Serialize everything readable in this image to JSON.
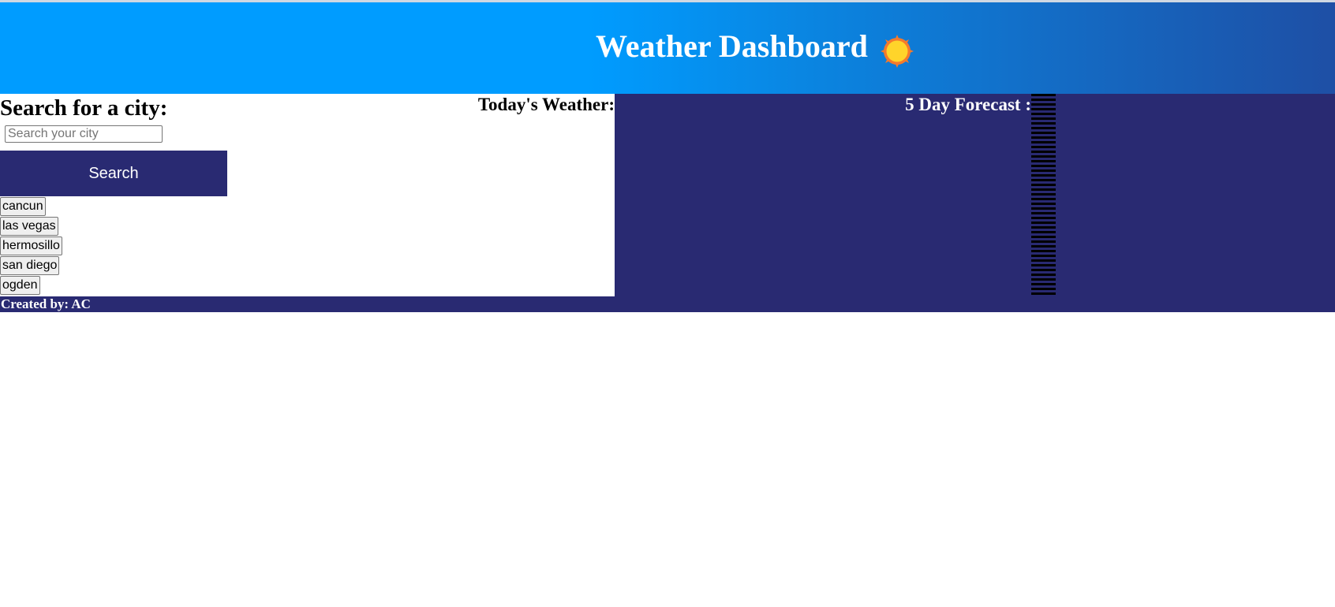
{
  "header": {
    "title": "Weather Dashboard",
    "icon": "sun-icon",
    "gradient_colors": [
      "#009cff",
      "#1e4fa5"
    ]
  },
  "search": {
    "title": "Search for a city:",
    "placeholder": "Search your city",
    "value": "",
    "button_label": "Search"
  },
  "history": {
    "cities": [
      "cancun",
      "las vegas",
      "hermosillo",
      "san diego",
      "ogden"
    ]
  },
  "today": {
    "label": "Today's Weather:"
  },
  "forecast": {
    "label": "5 Day Forecast :"
  },
  "footer": {
    "credit": "Created by: AC"
  },
  "colors": {
    "accent": "#292a72",
    "header_blue": "#009cff"
  }
}
